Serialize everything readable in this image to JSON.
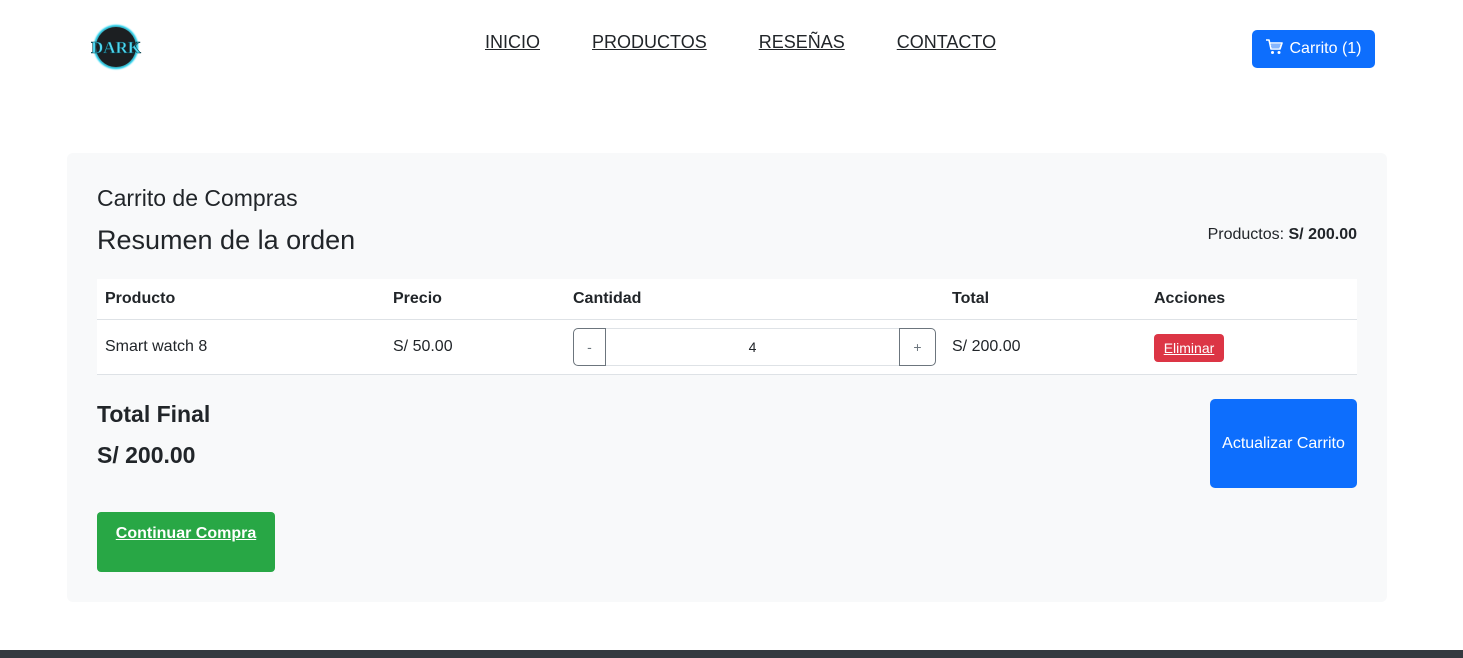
{
  "header": {
    "logo_text": "DARK",
    "nav": [
      "INICIO",
      "PRODUCTOS",
      "RESEÑAS",
      "CONTACTO"
    ],
    "cart_label": "Carrito (1)",
    "cart_icon": "cart-icon"
  },
  "cart": {
    "title": "Carrito de Compras",
    "subtitle": "Resumen de la orden",
    "products_label": "Productos:",
    "products_total": "S/ 200.00",
    "columns": [
      "Producto",
      "Precio",
      "Cantidad",
      "Total",
      "Acciones"
    ],
    "items": [
      {
        "name": "Smart watch 8",
        "price": "S/ 50.00",
        "qty_minus": "-",
        "quantity": "4",
        "qty_plus": "+",
        "total": "S/ 200.00",
        "action": "Eliminar"
      }
    ],
    "final_label": "Total Final",
    "final_value": "S/ 200.00",
    "update_label": "Actualizar Carrito",
    "continue_label": "Continuar Compra"
  },
  "colors": {
    "primary": "#0d6efd",
    "danger": "#dc3545",
    "success": "#28a745",
    "panel": "#f8f9fa",
    "footer": "#343a40"
  }
}
